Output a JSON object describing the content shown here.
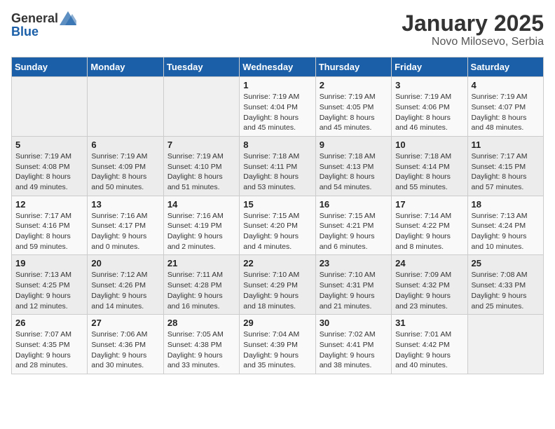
{
  "header": {
    "logo_general": "General",
    "logo_blue": "Blue",
    "title": "January 2025",
    "subtitle": "Novo Milosevo, Serbia"
  },
  "calendar": {
    "days_of_week": [
      "Sunday",
      "Monday",
      "Tuesday",
      "Wednesday",
      "Thursday",
      "Friday",
      "Saturday"
    ],
    "weeks": [
      [
        {
          "day": "",
          "info": ""
        },
        {
          "day": "",
          "info": ""
        },
        {
          "day": "",
          "info": ""
        },
        {
          "day": "1",
          "info": "Sunrise: 7:19 AM\nSunset: 4:04 PM\nDaylight: 8 hours\nand 45 minutes."
        },
        {
          "day": "2",
          "info": "Sunrise: 7:19 AM\nSunset: 4:05 PM\nDaylight: 8 hours\nand 45 minutes."
        },
        {
          "day": "3",
          "info": "Sunrise: 7:19 AM\nSunset: 4:06 PM\nDaylight: 8 hours\nand 46 minutes."
        },
        {
          "day": "4",
          "info": "Sunrise: 7:19 AM\nSunset: 4:07 PM\nDaylight: 8 hours\nand 48 minutes."
        }
      ],
      [
        {
          "day": "5",
          "info": "Sunrise: 7:19 AM\nSunset: 4:08 PM\nDaylight: 8 hours\nand 49 minutes."
        },
        {
          "day": "6",
          "info": "Sunrise: 7:19 AM\nSunset: 4:09 PM\nDaylight: 8 hours\nand 50 minutes."
        },
        {
          "day": "7",
          "info": "Sunrise: 7:19 AM\nSunset: 4:10 PM\nDaylight: 8 hours\nand 51 minutes."
        },
        {
          "day": "8",
          "info": "Sunrise: 7:18 AM\nSunset: 4:11 PM\nDaylight: 8 hours\nand 53 minutes."
        },
        {
          "day": "9",
          "info": "Sunrise: 7:18 AM\nSunset: 4:13 PM\nDaylight: 8 hours\nand 54 minutes."
        },
        {
          "day": "10",
          "info": "Sunrise: 7:18 AM\nSunset: 4:14 PM\nDaylight: 8 hours\nand 55 minutes."
        },
        {
          "day": "11",
          "info": "Sunrise: 7:17 AM\nSunset: 4:15 PM\nDaylight: 8 hours\nand 57 minutes."
        }
      ],
      [
        {
          "day": "12",
          "info": "Sunrise: 7:17 AM\nSunset: 4:16 PM\nDaylight: 8 hours\nand 59 minutes."
        },
        {
          "day": "13",
          "info": "Sunrise: 7:16 AM\nSunset: 4:17 PM\nDaylight: 9 hours\nand 0 minutes."
        },
        {
          "day": "14",
          "info": "Sunrise: 7:16 AM\nSunset: 4:19 PM\nDaylight: 9 hours\nand 2 minutes."
        },
        {
          "day": "15",
          "info": "Sunrise: 7:15 AM\nSunset: 4:20 PM\nDaylight: 9 hours\nand 4 minutes."
        },
        {
          "day": "16",
          "info": "Sunrise: 7:15 AM\nSunset: 4:21 PM\nDaylight: 9 hours\nand 6 minutes."
        },
        {
          "day": "17",
          "info": "Sunrise: 7:14 AM\nSunset: 4:22 PM\nDaylight: 9 hours\nand 8 minutes."
        },
        {
          "day": "18",
          "info": "Sunrise: 7:13 AM\nSunset: 4:24 PM\nDaylight: 9 hours\nand 10 minutes."
        }
      ],
      [
        {
          "day": "19",
          "info": "Sunrise: 7:13 AM\nSunset: 4:25 PM\nDaylight: 9 hours\nand 12 minutes."
        },
        {
          "day": "20",
          "info": "Sunrise: 7:12 AM\nSunset: 4:26 PM\nDaylight: 9 hours\nand 14 minutes."
        },
        {
          "day": "21",
          "info": "Sunrise: 7:11 AM\nSunset: 4:28 PM\nDaylight: 9 hours\nand 16 minutes."
        },
        {
          "day": "22",
          "info": "Sunrise: 7:10 AM\nSunset: 4:29 PM\nDaylight: 9 hours\nand 18 minutes."
        },
        {
          "day": "23",
          "info": "Sunrise: 7:10 AM\nSunset: 4:31 PM\nDaylight: 9 hours\nand 21 minutes."
        },
        {
          "day": "24",
          "info": "Sunrise: 7:09 AM\nSunset: 4:32 PM\nDaylight: 9 hours\nand 23 minutes."
        },
        {
          "day": "25",
          "info": "Sunrise: 7:08 AM\nSunset: 4:33 PM\nDaylight: 9 hours\nand 25 minutes."
        }
      ],
      [
        {
          "day": "26",
          "info": "Sunrise: 7:07 AM\nSunset: 4:35 PM\nDaylight: 9 hours\nand 28 minutes."
        },
        {
          "day": "27",
          "info": "Sunrise: 7:06 AM\nSunset: 4:36 PM\nDaylight: 9 hours\nand 30 minutes."
        },
        {
          "day": "28",
          "info": "Sunrise: 7:05 AM\nSunset: 4:38 PM\nDaylight: 9 hours\nand 33 minutes."
        },
        {
          "day": "29",
          "info": "Sunrise: 7:04 AM\nSunset: 4:39 PM\nDaylight: 9 hours\nand 35 minutes."
        },
        {
          "day": "30",
          "info": "Sunrise: 7:02 AM\nSunset: 4:41 PM\nDaylight: 9 hours\nand 38 minutes."
        },
        {
          "day": "31",
          "info": "Sunrise: 7:01 AM\nSunset: 4:42 PM\nDaylight: 9 hours\nand 40 minutes."
        },
        {
          "day": "",
          "info": ""
        }
      ]
    ]
  }
}
